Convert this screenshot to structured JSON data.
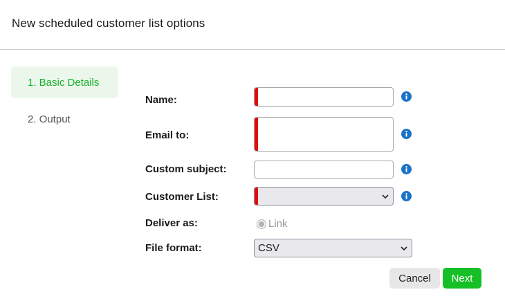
{
  "header": {
    "title": "New scheduled customer list options"
  },
  "steps": [
    {
      "label": "1. Basic Details",
      "active": true
    },
    {
      "label": "2. Output",
      "active": false
    }
  ],
  "form": {
    "name": {
      "label": "Name:",
      "value": "",
      "required": true
    },
    "email_to": {
      "label": "Email to:",
      "value": "",
      "required": true
    },
    "custom_subject": {
      "label": "Custom subject:",
      "value": "",
      "required": false
    },
    "customer_list": {
      "label": "Customer List:",
      "selected": "",
      "required": true
    },
    "deliver_as": {
      "label": "Deliver as:",
      "option": "Link",
      "selected": true,
      "disabled": true
    },
    "file_format": {
      "label": "File format:",
      "selected": "CSV"
    }
  },
  "buttons": {
    "cancel": "Cancel",
    "next": "Next"
  },
  "colors": {
    "accent": "#17bf26",
    "required": "#e40b0b",
    "info": "#1a73c8",
    "active_step_bg": "#ecf7ec"
  },
  "icons": {
    "info": "info-icon",
    "dropdown": "chevron-down-icon"
  }
}
